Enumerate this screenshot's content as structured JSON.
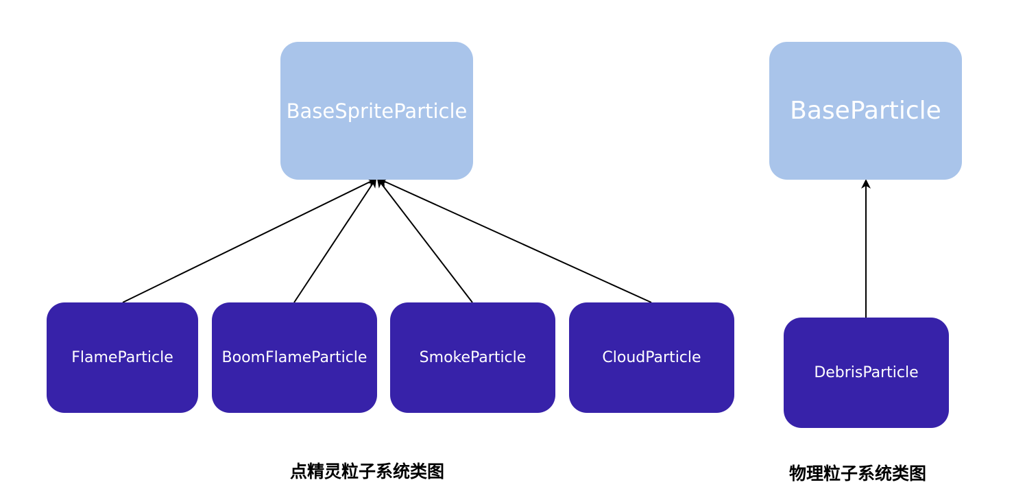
{
  "diagrams": [
    {
      "caption": "点精灵粒子系统类图",
      "base": "BaseSpriteParticle",
      "children": [
        "FlameParticle",
        "BoomFlameParticle",
        "SmokeParticle",
        "CloudParticle"
      ]
    },
    {
      "caption": "物理粒子系统类图",
      "base": "BaseParticle",
      "children": [
        "DebrisParticle"
      ]
    }
  ],
  "colors": {
    "base_fill": "#a9c4ea",
    "child_fill": "#3722a9",
    "text": "#ffffff",
    "edge": "#000000"
  }
}
